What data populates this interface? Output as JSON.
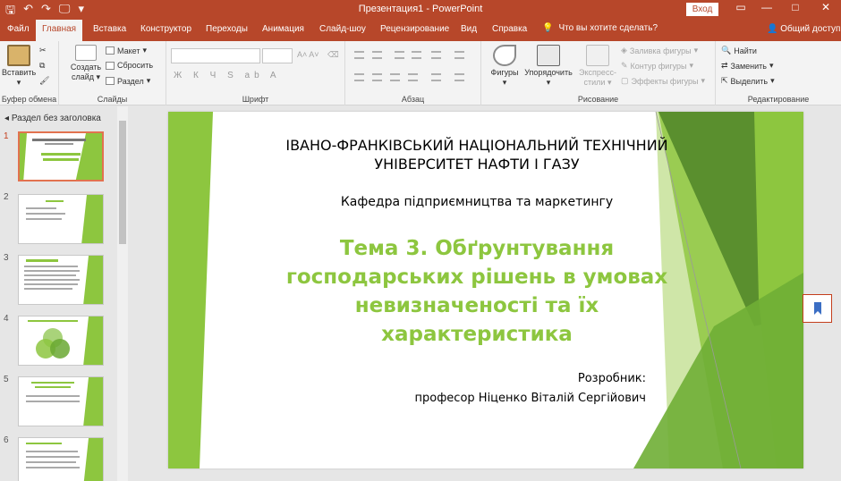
{
  "window": {
    "title": "Презентация1  -  PowerPoint",
    "signin": "Вход",
    "min_icon": "—",
    "max_icon": "□",
    "close_icon": "✕",
    "ribbon_opts_icon": "▭"
  },
  "qat": {
    "save": "🖫",
    "undo": "↶",
    "redo": "↷",
    "present": "🖵",
    "more": "▾"
  },
  "tabs": [
    "Файл",
    "Главная",
    "Вставка",
    "Конструктор",
    "Переходы",
    "Анимация",
    "Слайд-шоу",
    "Рецензирование",
    "Вид",
    "Справка"
  ],
  "tell_me": "Что вы хотите сделать?",
  "share": "Общий доступ",
  "ribbon": {
    "clipboard": {
      "paste": "Вставить",
      "label": "Буфер обмена"
    },
    "slides": {
      "new_slide_1": "Создать",
      "new_slide_2": "слайд",
      "layout": "Макет",
      "reset": "Сбросить",
      "section": "Раздел",
      "label": "Слайды"
    },
    "font": {
      "bold": "Ж",
      "italic": "К",
      "underline": "Ч",
      "strike": "S",
      "label": "Шрифт"
    },
    "paragraph": {
      "label": "Абзац"
    },
    "drawing": {
      "shapes": "Фигуры",
      "arrange": "Упорядочить",
      "styles_1": "Экспресс-",
      "styles_2": "стили",
      "fill": "Заливка фигуры",
      "outline": "Контур фигуры",
      "effects": "Эффекты фигуры",
      "label": "Рисование"
    },
    "editing": {
      "find": "Найти",
      "replace": "Заменить",
      "select": "Выделить",
      "label": "Редактирование"
    }
  },
  "slide_pane": {
    "section": "Раздел без заголовка",
    "numbers": [
      "1",
      "2",
      "3",
      "4",
      "5",
      "6"
    ]
  },
  "slide": {
    "university_line1": "ІВАНО-ФРАНКІВСЬКИЙ НАЦІОНАЛЬНИЙ ТЕХНІЧНИЙ",
    "university_line2": "УНІВЕРСИТЕТ НАФТИ І ГАЗУ",
    "department": "Кафедра підприємництва та маркетингу",
    "topic_line1": "Тема 3. Обґрунтування",
    "topic_line2": "господарських рішень в умовах",
    "topic_line3": "невизначеності та їх",
    "topic_line4": "характеристика",
    "author_label": "Розробник:",
    "author_name": "професор Ніценко Віталій Сергійович"
  },
  "colors": {
    "accent": "#b7472a",
    "green": "#8dc63f",
    "dark_green": "#4f7f2a"
  }
}
